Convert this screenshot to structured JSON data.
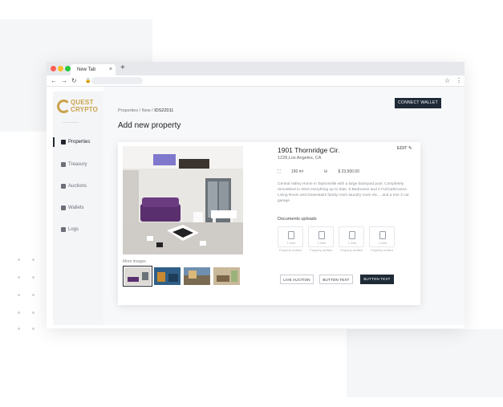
{
  "browser": {
    "tab_title": "New Tab",
    "tab_close": "×",
    "new_tab": "+"
  },
  "brand": {
    "line1": "QUEST",
    "line2": "CRYPTO",
    "color": "#c9a24a"
  },
  "sidebar": {
    "items": [
      {
        "label": "Properties",
        "icon": "building-icon",
        "active": true
      },
      {
        "label": "Treasury",
        "icon": "bank-icon",
        "active": false
      },
      {
        "label": "Auctions",
        "icon": "gavel-icon",
        "active": false
      },
      {
        "label": "Wallets",
        "icon": "wallet-icon",
        "active": false
      },
      {
        "label": "Logs",
        "icon": "calendar-icon",
        "active": false
      }
    ]
  },
  "header": {
    "connect_wallet": "CONNECT WALLET",
    "breadcrumb_prefix": "Properties / New / ",
    "breadcrumb_current": "IDS22011",
    "page_title": "Add new property"
  },
  "property": {
    "title": "1901 Thornridge Cir.",
    "address": "1228,Los Angeles, CA",
    "edit_label": "EDIT",
    "area": "190 m²",
    "price": "$ 23,500.00",
    "description": "Central Valley Home in Taylorsville with a large backyard pool. Completely remodeled in 2016 everything up to date. 6 Bedrooms and 2 Full bathrooms. Living Room and Downstairs family room laundry room etc… and a true 2 car garage.",
    "more_images_label": "More images",
    "documents_label": "Documents uploads",
    "documents": [
      {
        "size": "1.2mb",
        "note": "Property verified"
      },
      {
        "size": "1.2mb",
        "note": "Property verified"
      },
      {
        "size": "1.2mb",
        "note": "Property verified"
      },
      {
        "size": "1.2mb",
        "note": "Property verified"
      }
    ],
    "buttons": {
      "live_auction": "LIVE AUCTION",
      "button_text_1": "BUTTON TEXT",
      "button_text_2": "BUTTON TEXT"
    }
  },
  "colors": {
    "accent_dark": "#1f2a37",
    "brand_gold": "#c9a24a"
  }
}
